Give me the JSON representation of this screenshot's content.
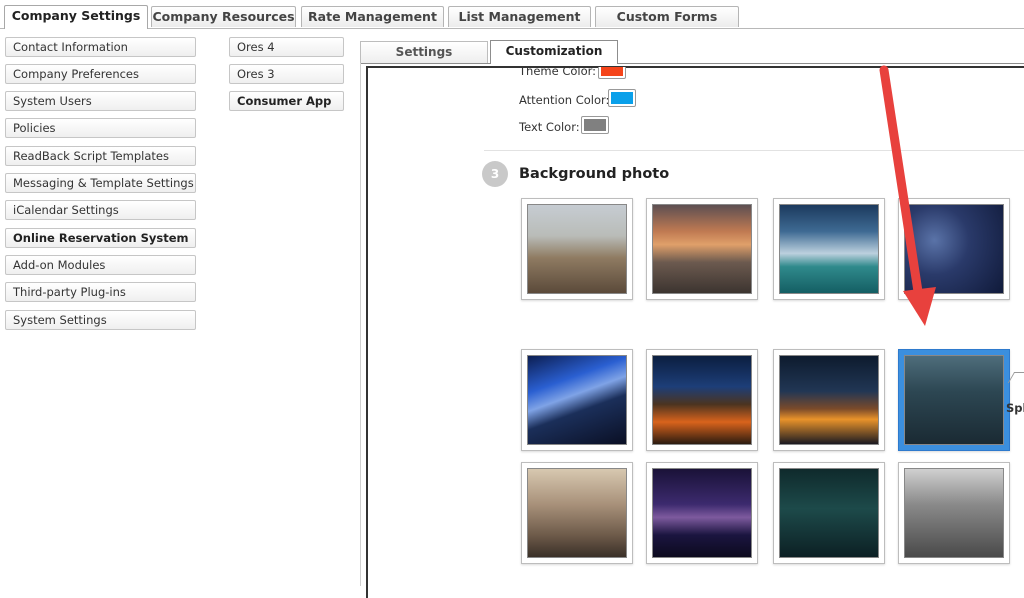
{
  "top_tabs": [
    "Company Settings",
    "Company Resources",
    "Rate Management",
    "List Management",
    "Custom Forms"
  ],
  "left_nav": [
    "Contact Information",
    "Company Preferences",
    "System Users",
    "Policies",
    "ReadBack Script Templates",
    "Messaging & Template Settings",
    "iCalendar Settings",
    "Online Reservation System",
    "Add-on Modules",
    "Third-party Plug-ins",
    "System Settings"
  ],
  "sub_nav": [
    "Ores 4",
    "Ores 3",
    "Consumer App"
  ],
  "content_tabs": [
    "Settings",
    "Customization"
  ],
  "colors": {
    "theme": {
      "label": "Theme Color:",
      "value": "#f5441a"
    },
    "attention": {
      "label": "Attention Color:",
      "value": "#0aa0ea"
    },
    "text": {
      "label": "Text Color:",
      "value": "#808080"
    }
  },
  "background_section": {
    "step": "3",
    "title": "Background photo",
    "selected_index": 7,
    "splash_label": "Spla"
  },
  "annotation_arrow_color": "#e8413d"
}
